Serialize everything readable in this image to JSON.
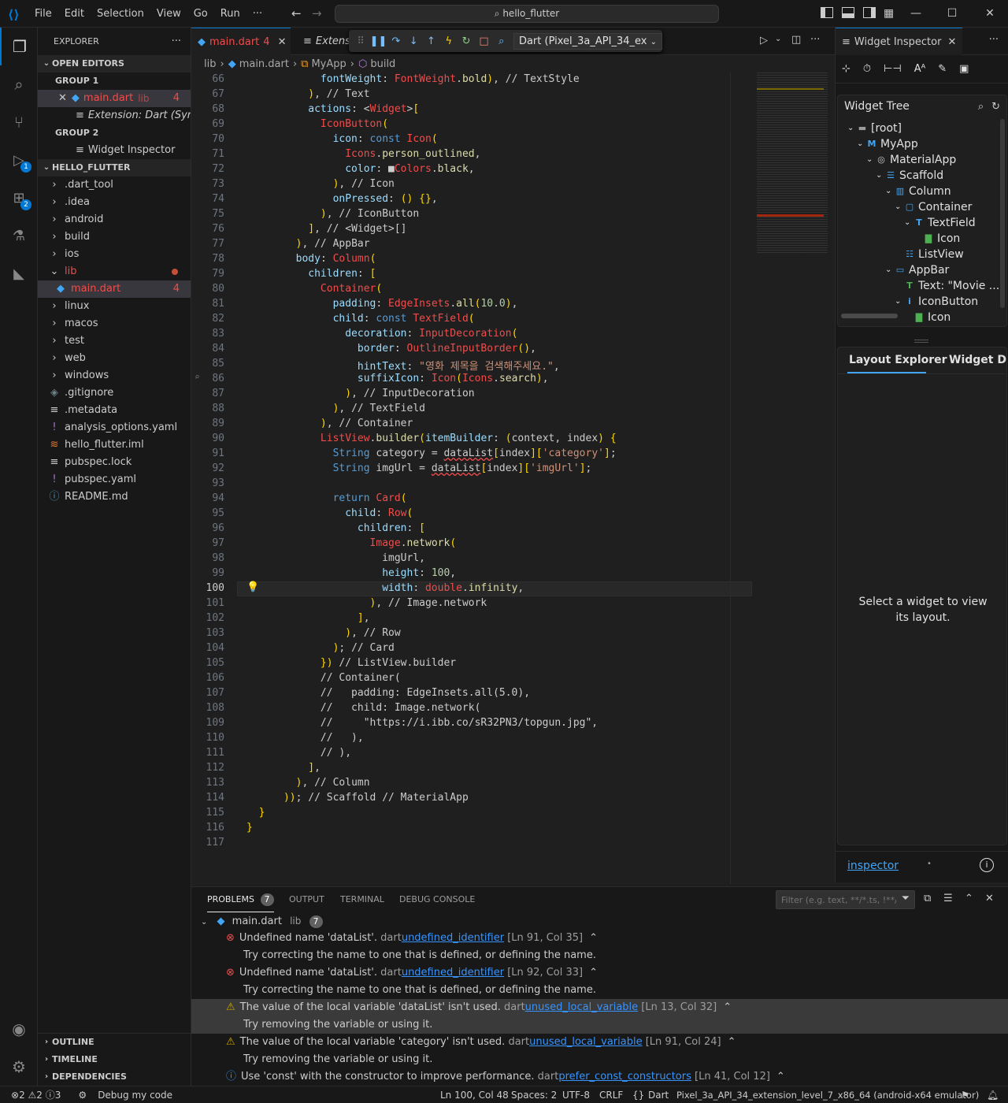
{
  "titlebar": {
    "menu": [
      "File",
      "Edit",
      "Selection",
      "View",
      "Go",
      "Run",
      "···"
    ],
    "search": "hello_flutter"
  },
  "activity_badges": {
    "debug": "1",
    "extensions": "2"
  },
  "explorer": {
    "title": "EXPLORER",
    "open_editors": "OPEN EDITORS",
    "group1": "GROUP 1",
    "group1_items": [
      {
        "label": "main.dart",
        "extra": "lib",
        "count": "4"
      },
      {
        "label": "Extension: Dart (Synt..."
      }
    ],
    "group2": "GROUP 2",
    "group2_items": [
      {
        "label": "Widget Inspector"
      }
    ],
    "project": "HELLO_FLUTTER",
    "files": [
      {
        "label": ".dart_tool",
        "type": "folder"
      },
      {
        "label": ".idea",
        "type": "folder"
      },
      {
        "label": "android",
        "type": "folder"
      },
      {
        "label": "build",
        "type": "folder"
      },
      {
        "label": "ios",
        "type": "folder"
      },
      {
        "label": "lib",
        "type": "folder-open"
      },
      {
        "label": "main.dart",
        "type": "file-child",
        "count": "4"
      },
      {
        "label": "linux",
        "type": "folder"
      },
      {
        "label": "macos",
        "type": "folder"
      },
      {
        "label": "test",
        "type": "folder"
      },
      {
        "label": "web",
        "type": "folder"
      },
      {
        "label": "windows",
        "type": "folder"
      },
      {
        "label": ".gitignore",
        "type": "file"
      },
      {
        "label": ".metadata",
        "type": "file"
      },
      {
        "label": "analysis_options.yaml",
        "type": "file"
      },
      {
        "label": "hello_flutter.iml",
        "type": "file"
      },
      {
        "label": "pubspec.lock",
        "type": "file"
      },
      {
        "label": "pubspec.yaml",
        "type": "file"
      },
      {
        "label": "README.md",
        "type": "file"
      }
    ],
    "outline": "OUTLINE",
    "timeline": "TIMELINE",
    "dependencies": "DEPENDENCIES"
  },
  "tabs": {
    "main": {
      "label": "main.dart",
      "count": "4"
    },
    "ext": "Extens",
    "device": "Dart (Pixel_3a_API_34_ex"
  },
  "breadcrumb": [
    "lib",
    "main.dart",
    "MyApp",
    "build"
  ],
  "code": {
    "start": 66,
    "current": 100,
    "lines": [
      "            fontWeight: FontWeight.bold), // TextStyle",
      "          ), // Text",
      "          actions: <Widget>[",
      "            IconButton(",
      "              icon: const Icon(",
      "                Icons.person_outlined,",
      "                color: ■Colors.black,",
      "              ), // Icon",
      "              onPressed: () {},",
      "            ), // IconButton",
      "          ], // <Widget>[]",
      "        ), // AppBar",
      "        body: Column(",
      "          children: [",
      "            Container(",
      "              padding: EdgeInsets.all(10.0),",
      "              child: const TextField(",
      "                decoration: InputDecoration(",
      "                  border: OutlineInputBorder(),",
      "                  hintText: \"영화 제목을 검색해주세요.\",",
      "                  suffixIcon: Icon(Icons.search),",
      "                ), // InputDecoration",
      "              ), // TextField",
      "            ), // Container",
      "            ListView.builder(itemBuilder: (context, index) {",
      "              String category = dataList[index]['category'];",
      "              String imgUrl = dataList[index]['imgUrl'];",
      "",
      "              return Card(",
      "                child: Row(",
      "                  children: [",
      "                    Image.network(",
      "                      imgUrl,",
      "                      height: 100,",
      "                      width: double.infinity,",
      "                    ), // Image.network",
      "                  ],",
      "                ), // Row",
      "              ); // Card",
      "            }) // ListView.builder",
      "            // Container(",
      "            //   padding: EdgeInsets.all(5.0),",
      "            //   child: Image.network(",
      "            //     \"https://i.ibb.co/sR32PN3/topgun.jpg\",",
      "            //   ),",
      "            // ),",
      "          ],",
      "        ), // Column",
      "      )); // Scaffold // MaterialApp",
      "  }",
      "}",
      ""
    ]
  },
  "inspector": {
    "title": "Widget Inspector",
    "tree_title": "Widget Tree",
    "tree": [
      {
        "label": "[root]",
        "depth": 0,
        "icon": "folder",
        "open": true
      },
      {
        "label": "MyApp",
        "depth": 1,
        "icon": "M",
        "open": true
      },
      {
        "label": "MaterialApp",
        "depth": 2,
        "icon": "material",
        "open": true
      },
      {
        "label": "Scaffold",
        "depth": 3,
        "icon": "scaffold",
        "open": true
      },
      {
        "label": "Column",
        "depth": 4,
        "icon": "column",
        "open": true
      },
      {
        "label": "Container",
        "depth": 5,
        "icon": "container",
        "open": true
      },
      {
        "label": "TextField",
        "depth": 6,
        "icon": "T",
        "open": true
      },
      {
        "label": "Icon",
        "depth": 7,
        "icon": "image"
      },
      {
        "label": "ListView",
        "depth": 5,
        "icon": "list"
      },
      {
        "label": "AppBar",
        "depth": 4,
        "icon": "appbar",
        "open": true
      },
      {
        "label": "Text: \"Movie ...",
        "depth": 5,
        "icon": "text"
      },
      {
        "label": "IconButton",
        "depth": 5,
        "icon": "info",
        "open": true
      },
      {
        "label": "Icon",
        "depth": 6,
        "icon": "image"
      }
    ],
    "layout_tab": "Layout Explorer",
    "details_tab": "Widget Deta",
    "empty_msg": "Select a widget to view its layout.",
    "footer_link": "inspector",
    "footer_dot": "•"
  },
  "panel": {
    "tabs": [
      "PROBLEMS",
      "OUTPUT",
      "TERMINAL",
      "DEBUG CONSOLE"
    ],
    "problems_count": "7",
    "filter_placeholder": "Filter (e.g. text, **/*.ts, !**/...",
    "file": "main.dart",
    "file_dir": "lib",
    "file_count": "7",
    "problems": [
      {
        "sev": "error",
        "msg": "Undefined name 'dataList'.",
        "src": "dart",
        "code": "undefined_identifier",
        "loc": "[Ln 91, Col 35]",
        "hint": "Try correcting the name to one that is defined, or defining the name."
      },
      {
        "sev": "error",
        "msg": "Undefined name 'dataList'.",
        "src": "dart",
        "code": "undefined_identifier",
        "loc": "[Ln 92, Col 33]",
        "hint": "Try correcting the name to one that is defined, or defining the name."
      },
      {
        "sev": "warning",
        "msg": "The value of the local variable 'dataList' isn't used.",
        "src": "dart",
        "code": "unused_local_variable",
        "loc": "[Ln 13, Col 32]",
        "hint": "Try removing the variable or using it.",
        "selected": true
      },
      {
        "sev": "warning",
        "msg": "The value of the local variable 'category' isn't used.",
        "src": "dart",
        "code": "unused_local_variable",
        "loc": "[Ln 91, Col 24]",
        "hint": "Try removing the variable or using it."
      },
      {
        "sev": "info",
        "msg": "Use 'const' with the constructor to improve performance.",
        "src": "dart",
        "code": "prefer_const_constructors",
        "loc": "[Ln 41, Col 12]"
      }
    ]
  },
  "status": {
    "errors": "2",
    "warnings": "2",
    "infos": "3",
    "debug": "Debug my code",
    "position": "Ln 100, Col 48",
    "spaces": "Spaces: 2",
    "encoding": "UTF-8",
    "eol": "CRLF",
    "lang": "Dart",
    "device": "Pixel_3a_API_34_extension_level_7_x86_64 (android-x64 emulator)"
  },
  "colors": {
    "accent": "#0078d4",
    "error": "#f14c4c",
    "warning": "#cca700",
    "info": "#3794ff"
  }
}
